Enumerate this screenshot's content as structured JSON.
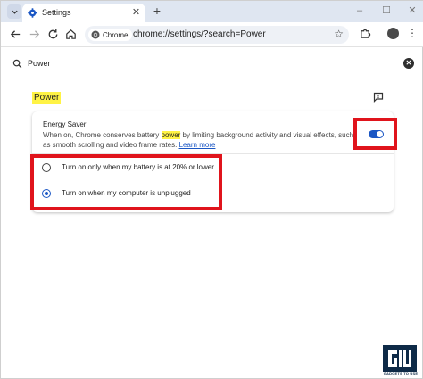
{
  "browser": {
    "tab_title": "Settings",
    "new_tab_label": "+",
    "window_controls": {
      "minimize": "–",
      "maximize": "☐",
      "close": "✕"
    },
    "chip_label": "Chrome",
    "url": "chrome://settings/?search=Power",
    "bookmark_star": "☆"
  },
  "search": {
    "value": "Power",
    "clear_label": "✕"
  },
  "section": {
    "title": "Power"
  },
  "energy_saver": {
    "title": "Energy Saver",
    "desc_before": "When on, Chrome conserves battery ",
    "desc_highlight": "power",
    "desc_after": " by limiting background activity and visual effects, such as smooth scrolling and video frame rates. ",
    "learn_more": "Learn more",
    "enabled": true
  },
  "options": [
    {
      "label": "Turn on only when my battery is at 20% or lower",
      "selected": false
    },
    {
      "label": "Turn on when my computer is unplugged",
      "selected": true
    }
  ],
  "colors": {
    "accent": "#1a56c4",
    "highlight": "#fff345",
    "annotation": "#e0141c",
    "tabstrip": "#dfe6f1"
  },
  "watermark": {
    "text": "GADGETS TO USE"
  }
}
